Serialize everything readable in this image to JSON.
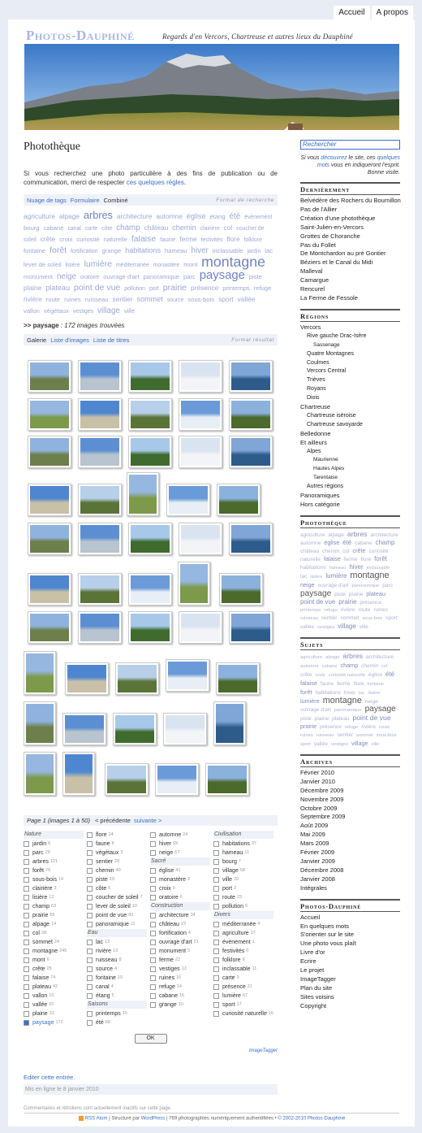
{
  "topnav": [
    "Accueil",
    "A propos"
  ],
  "site": {
    "title": "Photos-Dauphiné",
    "tagline": "Regards d'en Vercors, Chartreuse et autres lieux du Dauphiné"
  },
  "page": {
    "title": "Photothèque",
    "intro_text": "Si vous recherchez une photo particulière à des fins de publication ou de communication, merci de respecter ",
    "intro_link": "ces quelques règles",
    "intro_end": "."
  },
  "search_tabs": [
    "Nuage de tags",
    "Formulaire",
    "Combiné"
  ],
  "search_format": "Format de recherche",
  "cloud": [
    [
      "agriculture",
      8
    ],
    [
      "alpage",
      8
    ],
    [
      "arbres",
      14
    ],
    [
      "architecture",
      8
    ],
    [
      "automne",
      8
    ],
    [
      "église",
      9
    ],
    [
      "étang",
      7
    ],
    [
      "été",
      10
    ],
    [
      "évènement",
      6
    ],
    [
      "bourg",
      7
    ],
    [
      "cabane",
      7
    ],
    [
      "canal",
      6
    ],
    [
      "carte",
      6
    ],
    [
      "côte",
      6
    ],
    [
      "champ",
      10
    ],
    [
      "château",
      8
    ],
    [
      "chemin",
      9
    ],
    [
      "clairière",
      6
    ],
    [
      "col",
      8
    ],
    [
      "coucher de soleil",
      6
    ],
    [
      "crête",
      8
    ],
    [
      "croix",
      7
    ],
    [
      "curiosité",
      7
    ],
    [
      "naturelle",
      7
    ],
    [
      "falaise",
      11
    ],
    [
      "faune",
      7
    ],
    [
      "ferme",
      8
    ],
    [
      "festivités",
      6
    ],
    [
      "flore",
      8
    ],
    [
      "folklore",
      6
    ],
    [
      "fontaine",
      7
    ],
    [
      "forêt",
      11
    ],
    [
      "fortification",
      6
    ],
    [
      "grange",
      7
    ],
    [
      "habitations",
      9
    ],
    [
      "hameau",
      7
    ],
    [
      "hiver",
      10
    ],
    [
      "inclassable",
      7
    ],
    [
      "jardin",
      6
    ],
    [
      "lac",
      7
    ],
    [
      "lever de soleil",
      7
    ],
    [
      "lisière",
      6
    ],
    [
      "lumière",
      11
    ],
    [
      "méditerranée",
      6
    ],
    [
      "monastère",
      6
    ],
    [
      "mont",
      7
    ],
    [
      "montagne",
      21
    ],
    [
      "monument",
      7
    ],
    [
      "neige",
      10
    ],
    [
      "oratoire",
      6
    ],
    [
      "ouvrage d'art",
      7
    ],
    [
      "panoramique",
      7
    ],
    [
      "parc",
      7
    ],
    [
      "paysage",
      17
    ],
    [
      "piste",
      7
    ],
    [
      "plaine",
      8
    ],
    [
      "plateau",
      9
    ],
    [
      "point de vue",
      11
    ],
    [
      "pollution",
      6
    ],
    [
      "port",
      6
    ],
    [
      "prairie",
      11
    ],
    [
      "présence",
      8
    ],
    [
      "printemps",
      7
    ],
    [
      "refuge",
      7
    ],
    [
      "rivière",
      8
    ],
    [
      "route",
      7
    ],
    [
      "ruines",
      7
    ],
    [
      "ruisseau",
      7
    ],
    [
      "sentier",
      8
    ],
    [
      "sommet",
      9
    ],
    [
      "source",
      6
    ],
    [
      "sous-bois",
      7
    ],
    [
      "sport",
      8
    ],
    [
      "vallée",
      8
    ],
    [
      "vallon",
      7
    ],
    [
      "végétaux",
      7
    ],
    [
      "vestiges",
      6
    ],
    [
      "village",
      10
    ],
    [
      "ville",
      7
    ]
  ],
  "results": {
    "prefix": ">>",
    "tag": "paysage",
    "text": ": 172 images trouvées"
  },
  "result_tabs": [
    "Galerie",
    "Liste d'images",
    "Liste de titres"
  ],
  "result_format": "Format résultat",
  "pager": {
    "page": "Page 1 (images 1 à 50)",
    "prev": "< précédente",
    "next": "suivante >"
  },
  "filters": [
    [
      {
        "g": "Nature"
      },
      [
        "jardin",
        6
      ],
      [
        "parc",
        29
      ],
      [
        "arbres",
        121
      ],
      [
        "forêt",
        76
      ],
      [
        "sous-bois",
        14
      ],
      [
        "clairière",
        3
      ],
      [
        "lisière",
        12
      ],
      [
        "champ",
        63
      ],
      [
        "prairie",
        65
      ],
      [
        "alpage",
        14
      ],
      [
        "col",
        28
      ],
      [
        "sommet",
        24
      ],
      [
        "montagne",
        245
      ],
      [
        "mont",
        6
      ],
      [
        "crête",
        25
      ],
      [
        "falaise",
        74
      ],
      [
        "plateau",
        42
      ],
      [
        "vallon",
        10
      ],
      [
        "vallée",
        20
      ],
      [
        "plaine",
        31
      ],
      [
        "paysage",
        172,
        true
      ]
    ],
    [
      [
        "flore",
        24
      ],
      [
        "faune",
        8
      ],
      [
        "végétaux",
        3
      ],
      [
        "sentier",
        28
      ],
      [
        "chemin",
        40
      ],
      [
        "piste",
        19
      ],
      [
        "côte",
        6
      ],
      [
        "coucher de soleil",
        7
      ],
      [
        "lever de soleil",
        10
      ],
      [
        "point de vue",
        80
      ],
      [
        "panoramique",
        11
      ],
      {
        "g": "Eau"
      },
      [
        "lac",
        13
      ],
      [
        "rivière",
        13
      ],
      [
        "ruisseau",
        8
      ],
      [
        "source",
        4
      ],
      [
        "fontaine",
        10
      ],
      [
        "canal",
        4
      ],
      [
        "étang",
        5
      ],
      {
        "g": "Saisons"
      },
      [
        "printemps",
        10
      ],
      [
        "été",
        68
      ]
    ],
    [
      [
        "automne",
        24
      ],
      [
        "hiver",
        65
      ],
      [
        "neige",
        67
      ],
      {
        "g": "Sacré"
      },
      [
        "église",
        41
      ],
      [
        "monastère",
        2
      ],
      [
        "croix",
        9
      ],
      [
        "oratoire",
        6
      ],
      {
        "g": "Construction"
      },
      [
        "architecture",
        34
      ],
      [
        "château",
        23
      ],
      [
        "fortification",
        4
      ],
      [
        "ouvrage d'art",
        21
      ],
      [
        "monument",
        5
      ],
      [
        "ferme",
        22
      ],
      [
        "vestiges",
        13
      ],
      [
        "ruines",
        16
      ],
      [
        "refuge",
        14
      ],
      [
        "cabane",
        16
      ],
      [
        "grange",
        10
      ]
    ],
    [
      {
        "g": "Civilisation"
      },
      [
        "habitations",
        37
      ],
      [
        "hameau",
        11
      ],
      [
        "bourg",
        7
      ],
      [
        "village",
        58
      ],
      [
        "ville",
        20
      ],
      [
        "port",
        2
      ],
      [
        "route",
        23
      ],
      [
        "pollution",
        6
      ],
      {
        "g": "Divers"
      },
      [
        "méditerranée",
        4
      ],
      [
        "agriculture",
        27
      ],
      [
        "évènement",
        1
      ],
      [
        "festivités",
        0
      ],
      [
        "folklore",
        6
      ],
      [
        "inclassable",
        11
      ],
      [
        "carte",
        3
      ],
      [
        "présence",
        21
      ],
      [
        "lumière",
        67
      ],
      [
        "sport",
        17
      ],
      [
        "curiosité naturelle",
        16
      ]
    ]
  ],
  "ok": "OK",
  "imagetagger": "ImageTagger",
  "edit": "Editer cette entrée.",
  "posted": "Mis en ligne le 8 janvier 2010",
  "comments": "Commentaires et rétroliens sont actuellement inactifs sur cette page.",
  "sidebar": {
    "search_placeholder": "Rechercher",
    "note_a": "Si vous ",
    "note_link": "découvrez",
    "note_b": " le site, ces ",
    "note_link2": "quelques mots",
    "note_c": " vous en indiqueront l'esprit. Bonne visite.",
    "recent_title": "Dernièrement",
    "recent": [
      "Belvédère des Rochers du Bournillon",
      "Pas de l'Allier",
      "Création d'une photothèque",
      "Saint-Julien-en-Vercors",
      "Grottes de Choranche",
      "Pas du Follet",
      "De Montchardon au pré Gontier",
      "Béziers et le Canal du Midi",
      "Malleval",
      "Camargue",
      "Rencurel",
      "La Ferme de Fessole"
    ],
    "regions_title": "Régions",
    "regions": [
      [
        "Vercors",
        0
      ],
      [
        "Rive gauche Drac-Isère",
        1
      ],
      [
        "Sassenage",
        2
      ],
      [
        "Quatre Montagnes",
        1
      ],
      [
        "Coulmes",
        1
      ],
      [
        "Vercors Central",
        1
      ],
      [
        "Trièves",
        1
      ],
      [
        "Royans",
        1
      ],
      [
        "Diois",
        1
      ],
      [
        "Chartreuse",
        0
      ],
      [
        "Chartreuse iséroise",
        1
      ],
      [
        "Chartreuse savoyarde",
        1
      ],
      [
        "Belledonne",
        0
      ],
      [
        "Et ailleurs",
        0
      ],
      [
        "Alpes",
        1
      ],
      [
        "Maurienne",
        2
      ],
      [
        "Hautes Alpes",
        2
      ],
      [
        "Tarentaise",
        2
      ],
      [
        "Autres régions",
        1
      ],
      [
        "Panoramiques",
        0
      ],
      [
        "Hors catégorie",
        0
      ]
    ],
    "photo_title": "Photothèque",
    "photo_cloud": [
      [
        "agriculture",
        6
      ],
      [
        "alpage",
        6
      ],
      [
        "arbres",
        9
      ],
      [
        "architecture",
        6
      ],
      [
        "automne",
        6
      ],
      [
        "église",
        7
      ],
      [
        "été",
        8
      ],
      [
        "cabane",
        6
      ],
      [
        "champ",
        8
      ],
      [
        "château",
        6
      ],
      [
        "chemin",
        6
      ],
      [
        "col",
        6
      ],
      [
        "crête",
        7
      ],
      [
        "curiosité",
        6
      ],
      [
        "naturelle",
        6
      ],
      [
        "falaise",
        7
      ],
      [
        "ferme",
        6
      ],
      [
        "flore",
        6
      ],
      [
        "forêt",
        8
      ],
      [
        "habitations",
        6
      ],
      [
        "hameau",
        5
      ],
      [
        "hiver",
        8
      ],
      [
        "inclassable",
        5
      ],
      [
        "lac",
        6
      ],
      [
        "lisière",
        5
      ],
      [
        "lumière",
        8
      ],
      [
        "montagne",
        12
      ],
      [
        "neige",
        7
      ],
      [
        "ouvrage d'art",
        6
      ],
      [
        "panoramique",
        5
      ],
      [
        "parc",
        6
      ],
      [
        "paysage",
        11
      ],
      [
        "piste",
        6
      ],
      [
        "plaine",
        6
      ],
      [
        "plateau",
        7
      ],
      [
        "point de vue",
        8
      ],
      [
        "prairie",
        8
      ],
      [
        "présence",
        6
      ],
      [
        "printemps",
        5
      ],
      [
        "refuge",
        5
      ],
      [
        "rivière",
        6
      ],
      [
        "route",
        6
      ],
      [
        "ruines",
        6
      ],
      [
        "ruisseau",
        5
      ],
      [
        "sentier",
        6
      ],
      [
        "sommet",
        6
      ],
      [
        "sous-bois",
        5
      ],
      [
        "sport",
        6
      ],
      [
        "vallée",
        6
      ],
      [
        "vestiges",
        5
      ],
      [
        "village",
        8
      ],
      [
        "ville",
        6
      ]
    ],
    "subjects_title": "Sujets",
    "subjects_cloud": [
      [
        "agriculture",
        5
      ],
      [
        "alpage",
        5
      ],
      [
        "arbres",
        9
      ],
      [
        "architecture",
        6
      ],
      [
        "automne",
        5
      ],
      [
        "cabane",
        5
      ],
      [
        "champ",
        7
      ],
      [
        "chemin",
        6
      ],
      [
        "col",
        5
      ],
      [
        "crête",
        6
      ],
      [
        "croix",
        5
      ],
      [
        "curiosité naturelle",
        5
      ],
      [
        "église",
        6
      ],
      [
        "été",
        8
      ],
      [
        "falaise",
        7
      ],
      [
        "faune",
        6
      ],
      [
        "ferme",
        6
      ],
      [
        "flore",
        6
      ],
      [
        "fontaine",
        5
      ],
      [
        "forêt",
        7
      ],
      [
        "habitations",
        6
      ],
      [
        "hiver",
        6
      ],
      [
        "lac",
        5
      ],
      [
        "lisière",
        5
      ],
      [
        "lumière",
        7
      ],
      [
        "montagne",
        12
      ],
      [
        "neige",
        6
      ],
      [
        "ouvrage d'art",
        6
      ],
      [
        "panoramique",
        5
      ],
      [
        "paysage",
        11
      ],
      [
        "piste",
        6
      ],
      [
        "plaine",
        6
      ],
      [
        "plateau",
        6
      ],
      [
        "point de vue",
        9
      ],
      [
        "prairie",
        7
      ],
      [
        "présence",
        6
      ],
      [
        "refuge",
        5
      ],
      [
        "rivière",
        6
      ],
      [
        "route",
        5
      ],
      [
        "ruines",
        5
      ],
      [
        "ruisseau",
        5
      ],
      [
        "sentier",
        6
      ],
      [
        "sommet",
        5
      ],
      [
        "sous-bois",
        5
      ],
      [
        "sport",
        5
      ],
      [
        "vallée",
        6
      ],
      [
        "vestiges",
        5
      ],
      [
        "village",
        7
      ],
      [
        "ville",
        5
      ]
    ],
    "archives_title": "Archives",
    "archives": [
      "Février 2010",
      "Janvier 2010",
      "Décembre 2009",
      "Novembre 2009",
      "Octobre 2009",
      "Septembre 2009",
      "Août 2009",
      "Mai 2009",
      "Mars 2009",
      "Février 2009",
      "Janvier 2009",
      "Décembre 2008",
      "Janvier 2008",
      "Intégrales"
    ],
    "pd_title": "Photos-Dauphiné",
    "pd_links": [
      "Accueil",
      "En quelques mots",
      "S'orienter sur le site",
      "Une photo vous plaît",
      "Livre d'or",
      "Ecrire",
      "Le projet",
      "ImageTagger",
      "Plan du site",
      "Sites voisins",
      "Copyright"
    ]
  },
  "footer": {
    "rss": "RSS Atom",
    "a": " | Structuré par ",
    "wp": "WordPress",
    "b": " | 769 photographies numériquement authentifiées • ",
    "c": "© 2002-2010 Photos-Dauphiné"
  }
}
